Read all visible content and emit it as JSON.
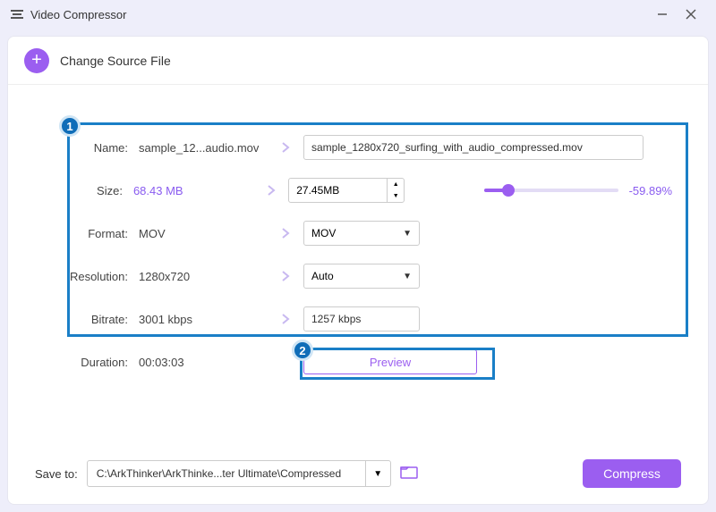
{
  "app": {
    "title": "Video Compressor"
  },
  "header": {
    "change_source": "Change Source File"
  },
  "labels": {
    "name": "Name:",
    "size": "Size:",
    "format": "Format:",
    "resolution": "Resolution:",
    "bitrate": "Bitrate:",
    "duration": "Duration:",
    "save_to": "Save to:"
  },
  "source": {
    "name": "sample_12...audio.mov",
    "size": "68.43 MB",
    "format": "MOV",
    "resolution": "1280x720",
    "bitrate": "3001 kbps",
    "duration": "00:03:03"
  },
  "target": {
    "name": "sample_1280x720_surfing_with_audio_compressed.mov",
    "size": "27.45MB",
    "format": "MOV",
    "resolution": "Auto",
    "bitrate": "1257 kbps",
    "reduction": "-59.89%"
  },
  "buttons": {
    "preview": "Preview",
    "compress": "Compress"
  },
  "footer": {
    "path": "C:\\ArkThinker\\ArkThinke...ter Ultimate\\Compressed"
  },
  "callouts": {
    "one": "1",
    "two": "2"
  }
}
